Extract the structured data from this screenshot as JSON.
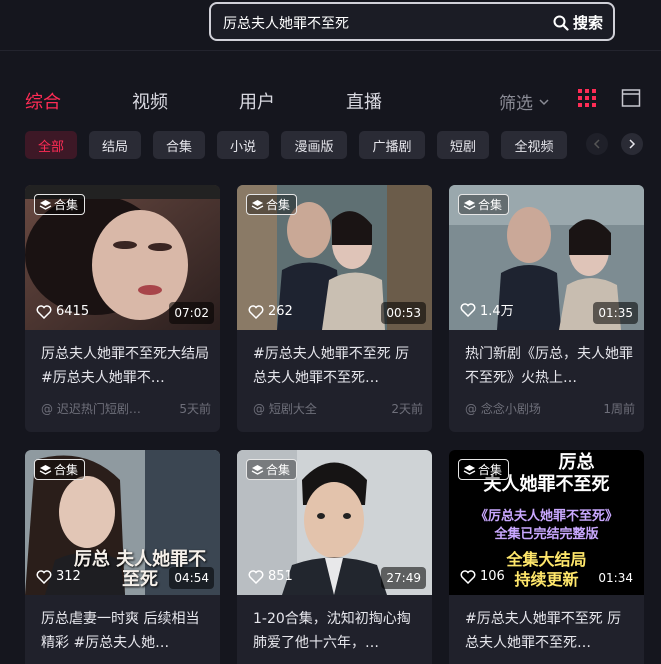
{
  "search": {
    "query": "厉总夫人她罪不至死",
    "button_label": "搜索"
  },
  "tabs": [
    {
      "label": "综合"
    },
    {
      "label": "视频"
    },
    {
      "label": "用户"
    },
    {
      "label": "直播"
    }
  ],
  "filter_label": "筛选",
  "chips": [
    "全部",
    "结局",
    "合集",
    "小说",
    "漫画版",
    "广播剧",
    "短剧",
    "全视频"
  ],
  "colors": {
    "accent": "#fe2c55",
    "background": "#15161e",
    "card": "#20212b"
  },
  "cards": [
    {
      "badge": "合集",
      "likes": "6415",
      "duration": "07:02",
      "title": "厉总夫人她罪不至死大结局#厉总夫人她罪不…",
      "author": "@ 迟迟热门短剧…",
      "time": "5天前"
    },
    {
      "badge": "合集",
      "likes": "262",
      "duration": "00:53",
      "title": "#厉总夫人她罪不至死 厉总夫人她罪不至死…",
      "author": "@ 短剧大全",
      "time": "2天前"
    },
    {
      "badge": "合集",
      "likes": "1.4万",
      "duration": "01:35",
      "title": "热门新剧《厉总，夫人她罪不至死》火热上…",
      "author": "@ 念念小剧场",
      "time": "1周前"
    },
    {
      "badge": "合集",
      "likes": "312",
      "duration": "04:54",
      "title": "厉总虐妻一时爽 后续相当精彩 #厉总夫人她…",
      "overlay": "厉总 夫人她罪不至死"
    },
    {
      "badge": "合集",
      "likes": "851",
      "duration": "27:49",
      "title": "1-20合集，沈知初掏心掏肺爱了他十六年，…"
    },
    {
      "badge": "合集",
      "likes": "106",
      "duration": "01:34",
      "title": "#厉总夫人她罪不至死 厉总夫人她罪不至死…",
      "poster": {
        "line1": "厉总",
        "line2": "夫人她罪不至死",
        "line3": "《厉总夫人她罪不至死》",
        "line4": "全集已完结完整版",
        "line5": "全集大结局",
        "line6": "持续更新"
      }
    }
  ]
}
